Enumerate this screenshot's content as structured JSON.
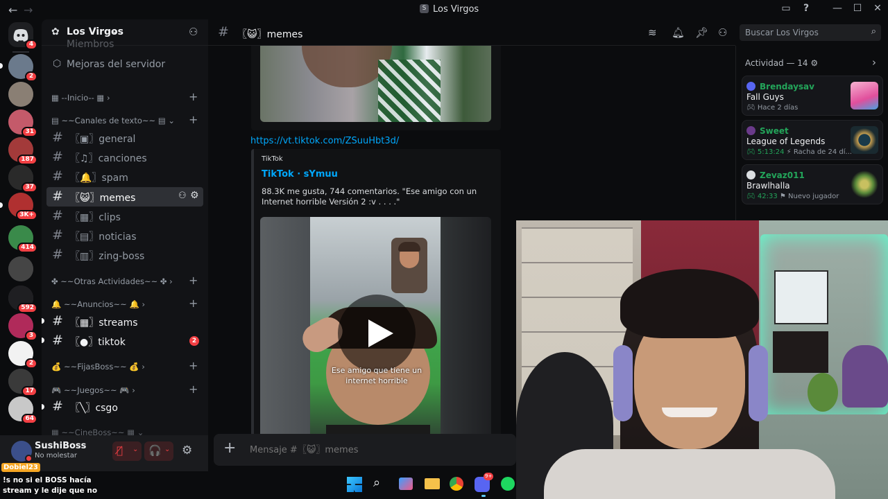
{
  "window": {
    "title": "Los Virgos"
  },
  "guilds": {
    "home_badge": "4",
    "items": [
      {
        "badge": "2",
        "color": "#6b7a8c"
      },
      {
        "badge": "",
        "color": "#8a7f74"
      },
      {
        "badge": "31",
        "color": "#c45a6a"
      },
      {
        "badge": "187",
        "color": "#a33a3a"
      },
      {
        "badge": "37",
        "color": "#2a2a2a"
      },
      {
        "badge": "3K+",
        "color": "#b03030"
      },
      {
        "badge": "414",
        "color": "#3a8a4a"
      },
      {
        "badge": "",
        "color": "#454545"
      },
      {
        "badge": "592",
        "color": "#1f1f22"
      },
      {
        "badge": "3",
        "color": "#b02a5a"
      },
      {
        "badge": "2",
        "color": "#f2f2f2"
      },
      {
        "badge": "17",
        "color": "#3a3a3a"
      },
      {
        "badge": "64",
        "color": "#c8c8c8"
      }
    ]
  },
  "server": {
    "name": "Los Virgos",
    "top_item_faded": "Miembros",
    "boost_item": "Mejoras del servidor",
    "categories": {
      "inicio": "--Inicio--",
      "texto": "~~Canales de texto~~",
      "otras": "~~Otras Actividades~~",
      "anuncios": "~~Anuncios~~",
      "fijas": "~~FijasBoss~~",
      "juegos": "~~Juegos~~",
      "cine": "~~CineBoss~~"
    },
    "channels": {
      "general": "general",
      "canciones": "canciones",
      "spam": "spam",
      "memes": "memes",
      "clips": "clips",
      "noticias": "noticias",
      "zing": "zing-boss",
      "streams": "streams",
      "tiktok": "tiktok",
      "tiktok_badge": "2",
      "csgo": "csgo"
    }
  },
  "user": {
    "name": "SushiBoss",
    "status": "No molestar"
  },
  "chat": {
    "channel_name": "memes",
    "search_placeholder": "Buscar Los Virgos",
    "link": "https://vt.tiktok.com/ZSuuHbt3d/",
    "embed": {
      "provider": "TikTok",
      "title": "TikTok · sYmuu",
      "description": "88.3K me gusta, 744 comentarios. \"Ese amigo con un Internet horrible Versión 2 :v . . . .\"",
      "caption": "Ese amigo que tiene un internet horrible"
    },
    "message_placeholder": "Mensaje #〖😺〗memes"
  },
  "activity": {
    "header": "Actividad — 14",
    "cards": [
      {
        "user": "Brendaysav",
        "game": "Fall Guys",
        "sub": "Hace 2 días",
        "color": "#e14f9c"
      },
      {
        "user": "Sweet",
        "game": "League of Legends",
        "time": "5:13:24",
        "sub": "Racha de 24 dí...",
        "color": "#8a6a2a"
      },
      {
        "user": "Zevaz011",
        "game": "Brawlhalla",
        "time": "42:33",
        "sub": "Nuevo jugador",
        "color": "#5a8a3a"
      }
    ]
  },
  "stream_chat": {
    "user": "Dobiel23",
    "message": "!s no si el BOSS hacía stream y le dije que no"
  },
  "taskbar": {
    "discord_badge": "9+"
  }
}
